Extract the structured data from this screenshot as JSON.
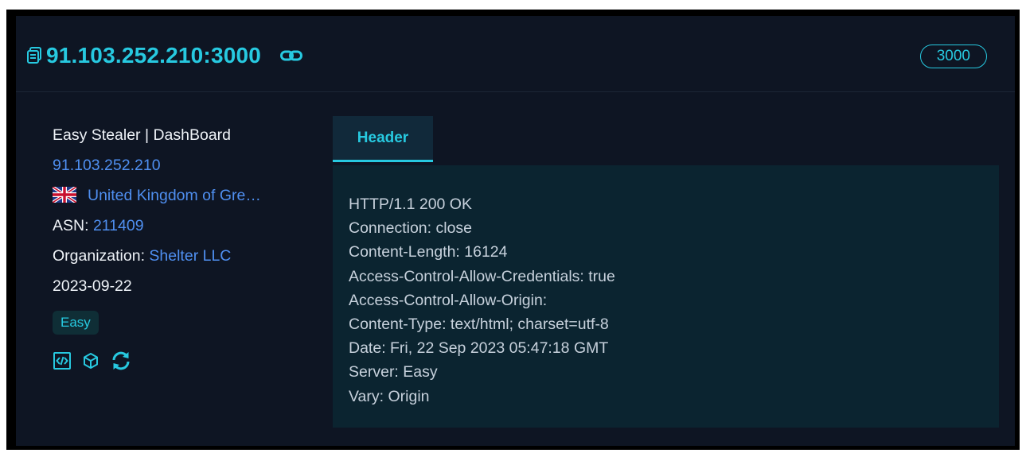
{
  "card": {
    "title": "91.103.252.210:3000",
    "port_badge": "3000",
    "page_title": "Easy Stealer | DashBoard",
    "ip": "91.103.252.210",
    "country": "United Kingdom of Gre…",
    "asn_label": "ASN:",
    "asn_value": "211409",
    "org_label": "Organization:",
    "org_value": "Shelter LLC",
    "date": "2023-09-22",
    "tag": "Easy",
    "icons": [
      "html-code-icon",
      "cube-icon",
      "refresh-icon"
    ]
  },
  "tabs": [
    {
      "label": "Header"
    }
  ],
  "header_lines": [
    "HTTP/1.1 200 OK",
    "Connection: close",
    "Content-Length: 16124",
    "Access-Control-Allow-Credentials: true",
    "Access-Control-Allow-Origin:",
    "Content-Type: text/html; charset=utf-8",
    "Date: Fri, 22 Sep 2023 05:47:18 GMT",
    "Server: Easy",
    "Vary: Origin"
  ],
  "colors": {
    "accent": "#27c9e0",
    "link": "#4f8ff0",
    "card_bg": "#0e1523",
    "panel_bg": "#0b2430"
  }
}
